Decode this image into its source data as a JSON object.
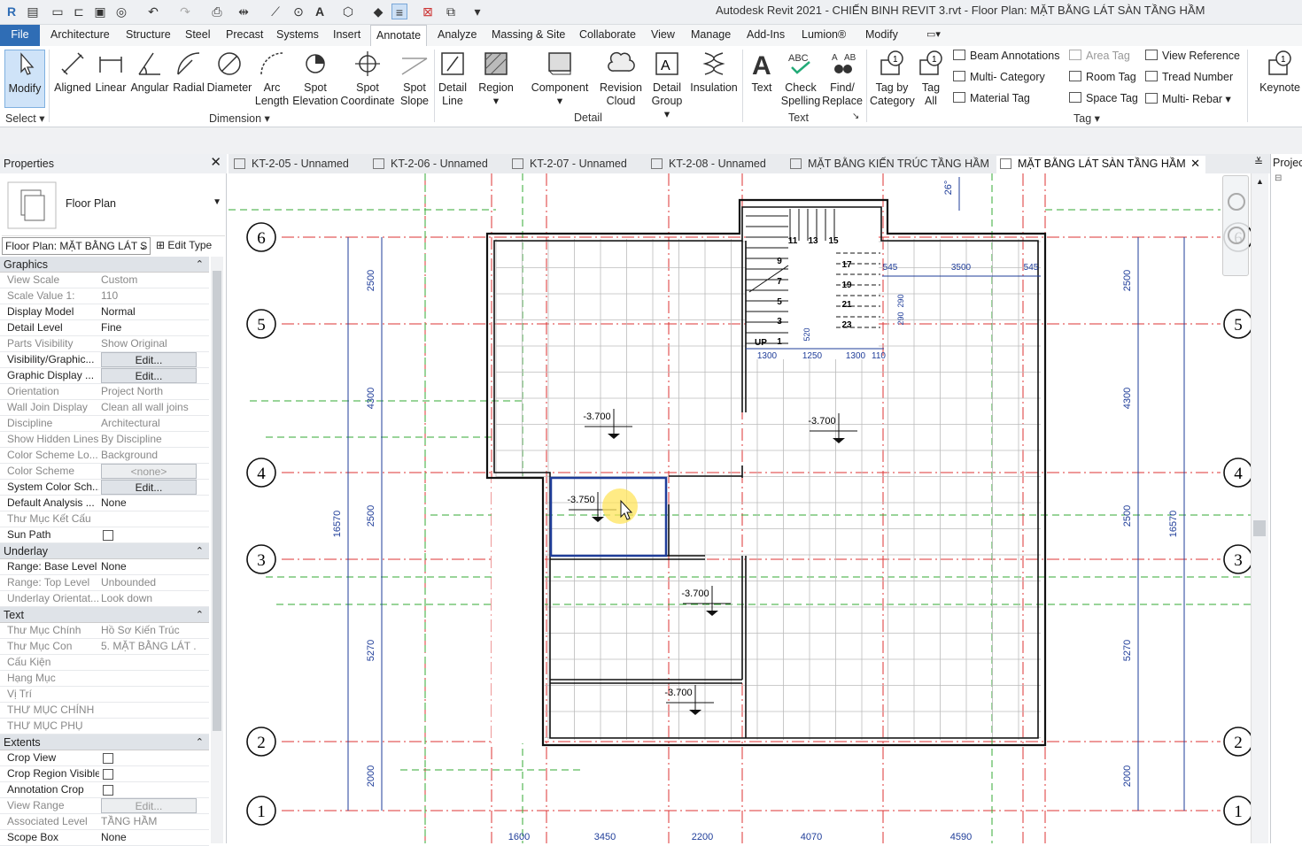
{
  "app": {
    "title": "Autodesk Revit 2021 - CHIẾN BINH REVIT 3.rvt - Floor Plan: MẶT BẰNG LÁT SÀN TẦNG HẦM",
    "logo": "R"
  },
  "menu": {
    "file": "File",
    "tabs": [
      "Architecture",
      "Structure",
      "Steel",
      "Precast",
      "Systems",
      "Insert",
      "Annotate",
      "Analyze",
      "Massing & Site",
      "Collaborate",
      "View",
      "Manage",
      "Add-Ins",
      "Lumion®",
      "Modify"
    ],
    "active": "Annotate"
  },
  "ribbon": {
    "modify": "Modify",
    "select_panel": "Select",
    "dimension": [
      "Aligned",
      "Linear",
      "Angular",
      "Radial",
      "Diameter",
      "Arc Length",
      "Spot Elevation",
      "Spot Coordinate",
      "Spot Slope"
    ],
    "dimension_panel": "Dimension",
    "detail": [
      "Detail Line",
      "Region",
      "Component",
      "Revision Cloud",
      "Detail Group",
      "Insulation"
    ],
    "detail_panel": "Detail",
    "text": [
      "Text",
      "Check Spelling",
      "Find/ Replace"
    ],
    "text_panel": "Text",
    "tag_big": [
      "Tag by Category",
      "Tag All"
    ],
    "tag_small": [
      "Beam Annotations",
      "Multi- Category",
      "Material  Tag",
      "Area  Tag",
      "Room  Tag",
      "Space  Tag",
      "View Reference",
      "Tread  Number",
      "Multi- Rebar"
    ],
    "tag_panel": "Tag",
    "keynote": "Keynote"
  },
  "properties": {
    "title": "Properties",
    "type_name": "Floor Plan",
    "instance": "Floor Plan: MẶT BẰNG LÁT S",
    "edit_type": "Edit Type",
    "graphics_header": "Graphics",
    "graphics": [
      [
        "View Scale",
        "Custom"
      ],
      [
        "Scale Value    1:",
        "110"
      ],
      [
        "Display Model",
        "Normal"
      ],
      [
        "Detail Level",
        "Fine"
      ],
      [
        "Parts Visibility",
        "Show Original"
      ],
      [
        "Visibility/Graphic...",
        "Edit..."
      ],
      [
        "Graphic Display ...",
        "Edit..."
      ],
      [
        "Orientation",
        "Project North"
      ],
      [
        "Wall Join Display",
        "Clean all wall joins"
      ],
      [
        "Discipline",
        "Architectural"
      ],
      [
        "Show Hidden Lines",
        "By Discipline"
      ],
      [
        "Color Scheme Lo...",
        "Background"
      ],
      [
        "Color Scheme",
        "<none>"
      ],
      [
        "System Color Sch...",
        "Edit..."
      ],
      [
        "Default Analysis ...",
        "None"
      ],
      [
        "Thư Mục Kết Cấu",
        ""
      ],
      [
        "Sun Path",
        ""
      ]
    ],
    "underlay_header": "Underlay",
    "underlay": [
      [
        "Range: Base Level",
        "None"
      ],
      [
        "Range: Top Level",
        "Unbounded"
      ],
      [
        "Underlay Orientat...",
        "Look down"
      ]
    ],
    "text_header": "Text",
    "text": [
      [
        "Thư Mục Chính",
        "Hồ Sơ Kiến Trúc"
      ],
      [
        "Thư Mục Con",
        "5. MẶT BẰNG LÁT ..."
      ],
      [
        "Cấu Kiện",
        ""
      ],
      [
        "Hạng Mục",
        ""
      ],
      [
        "Vị Trí",
        ""
      ],
      [
        "THƯ MỤC CHÍNH",
        ""
      ],
      [
        "THƯ MỤC PHỤ",
        ""
      ]
    ],
    "extents_header": "Extents",
    "extents": [
      [
        "Crop View",
        ""
      ],
      [
        "Crop Region Visible",
        ""
      ],
      [
        "Annotation Crop",
        ""
      ],
      [
        "View Range",
        "Edit..."
      ],
      [
        "Associated Level",
        "TẦNG HẦM"
      ],
      [
        "Scope Box",
        "None"
      ]
    ]
  },
  "view_tabs": [
    "KT-2-05 - Unnamed",
    "KT-2-06 - Unnamed",
    "KT-2-07 - Unnamed",
    "KT-2-08 - Unnamed",
    "MẶT BẰNG KIẾN TRÚC TẦNG HẦM",
    "MẶT BẰNG LÁT SÀN TẦNG HẦM"
  ],
  "active_view": "MẶT BẰNG LÁT SÀN TẦNG HẦM",
  "project_browser": "Projec",
  "drawing": {
    "grids": [
      "6",
      "5",
      "4",
      "3",
      "2",
      "1"
    ],
    "dims_left": [
      "2500",
      "4300",
      "2500",
      "5270",
      "2000"
    ],
    "total_dim": "16570",
    "dims_bottom": [
      "1600",
      "3450",
      "2200",
      "4070",
      "4590"
    ],
    "stair_dims": [
      "545",
      "3500",
      "545",
      "1300",
      "1250",
      "1300",
      "110",
      "520",
      "290",
      "290"
    ],
    "stair_numbers": [
      "11",
      "13",
      "15",
      "9",
      "17",
      "7",
      "19",
      "5",
      "21",
      "3",
      "23",
      "1"
    ],
    "stair_up": "UP",
    "angle": "26°",
    "spots": [
      "-3.700",
      "-3.700",
      "-3.750",
      "-3.700",
      "-3.700"
    ]
  }
}
